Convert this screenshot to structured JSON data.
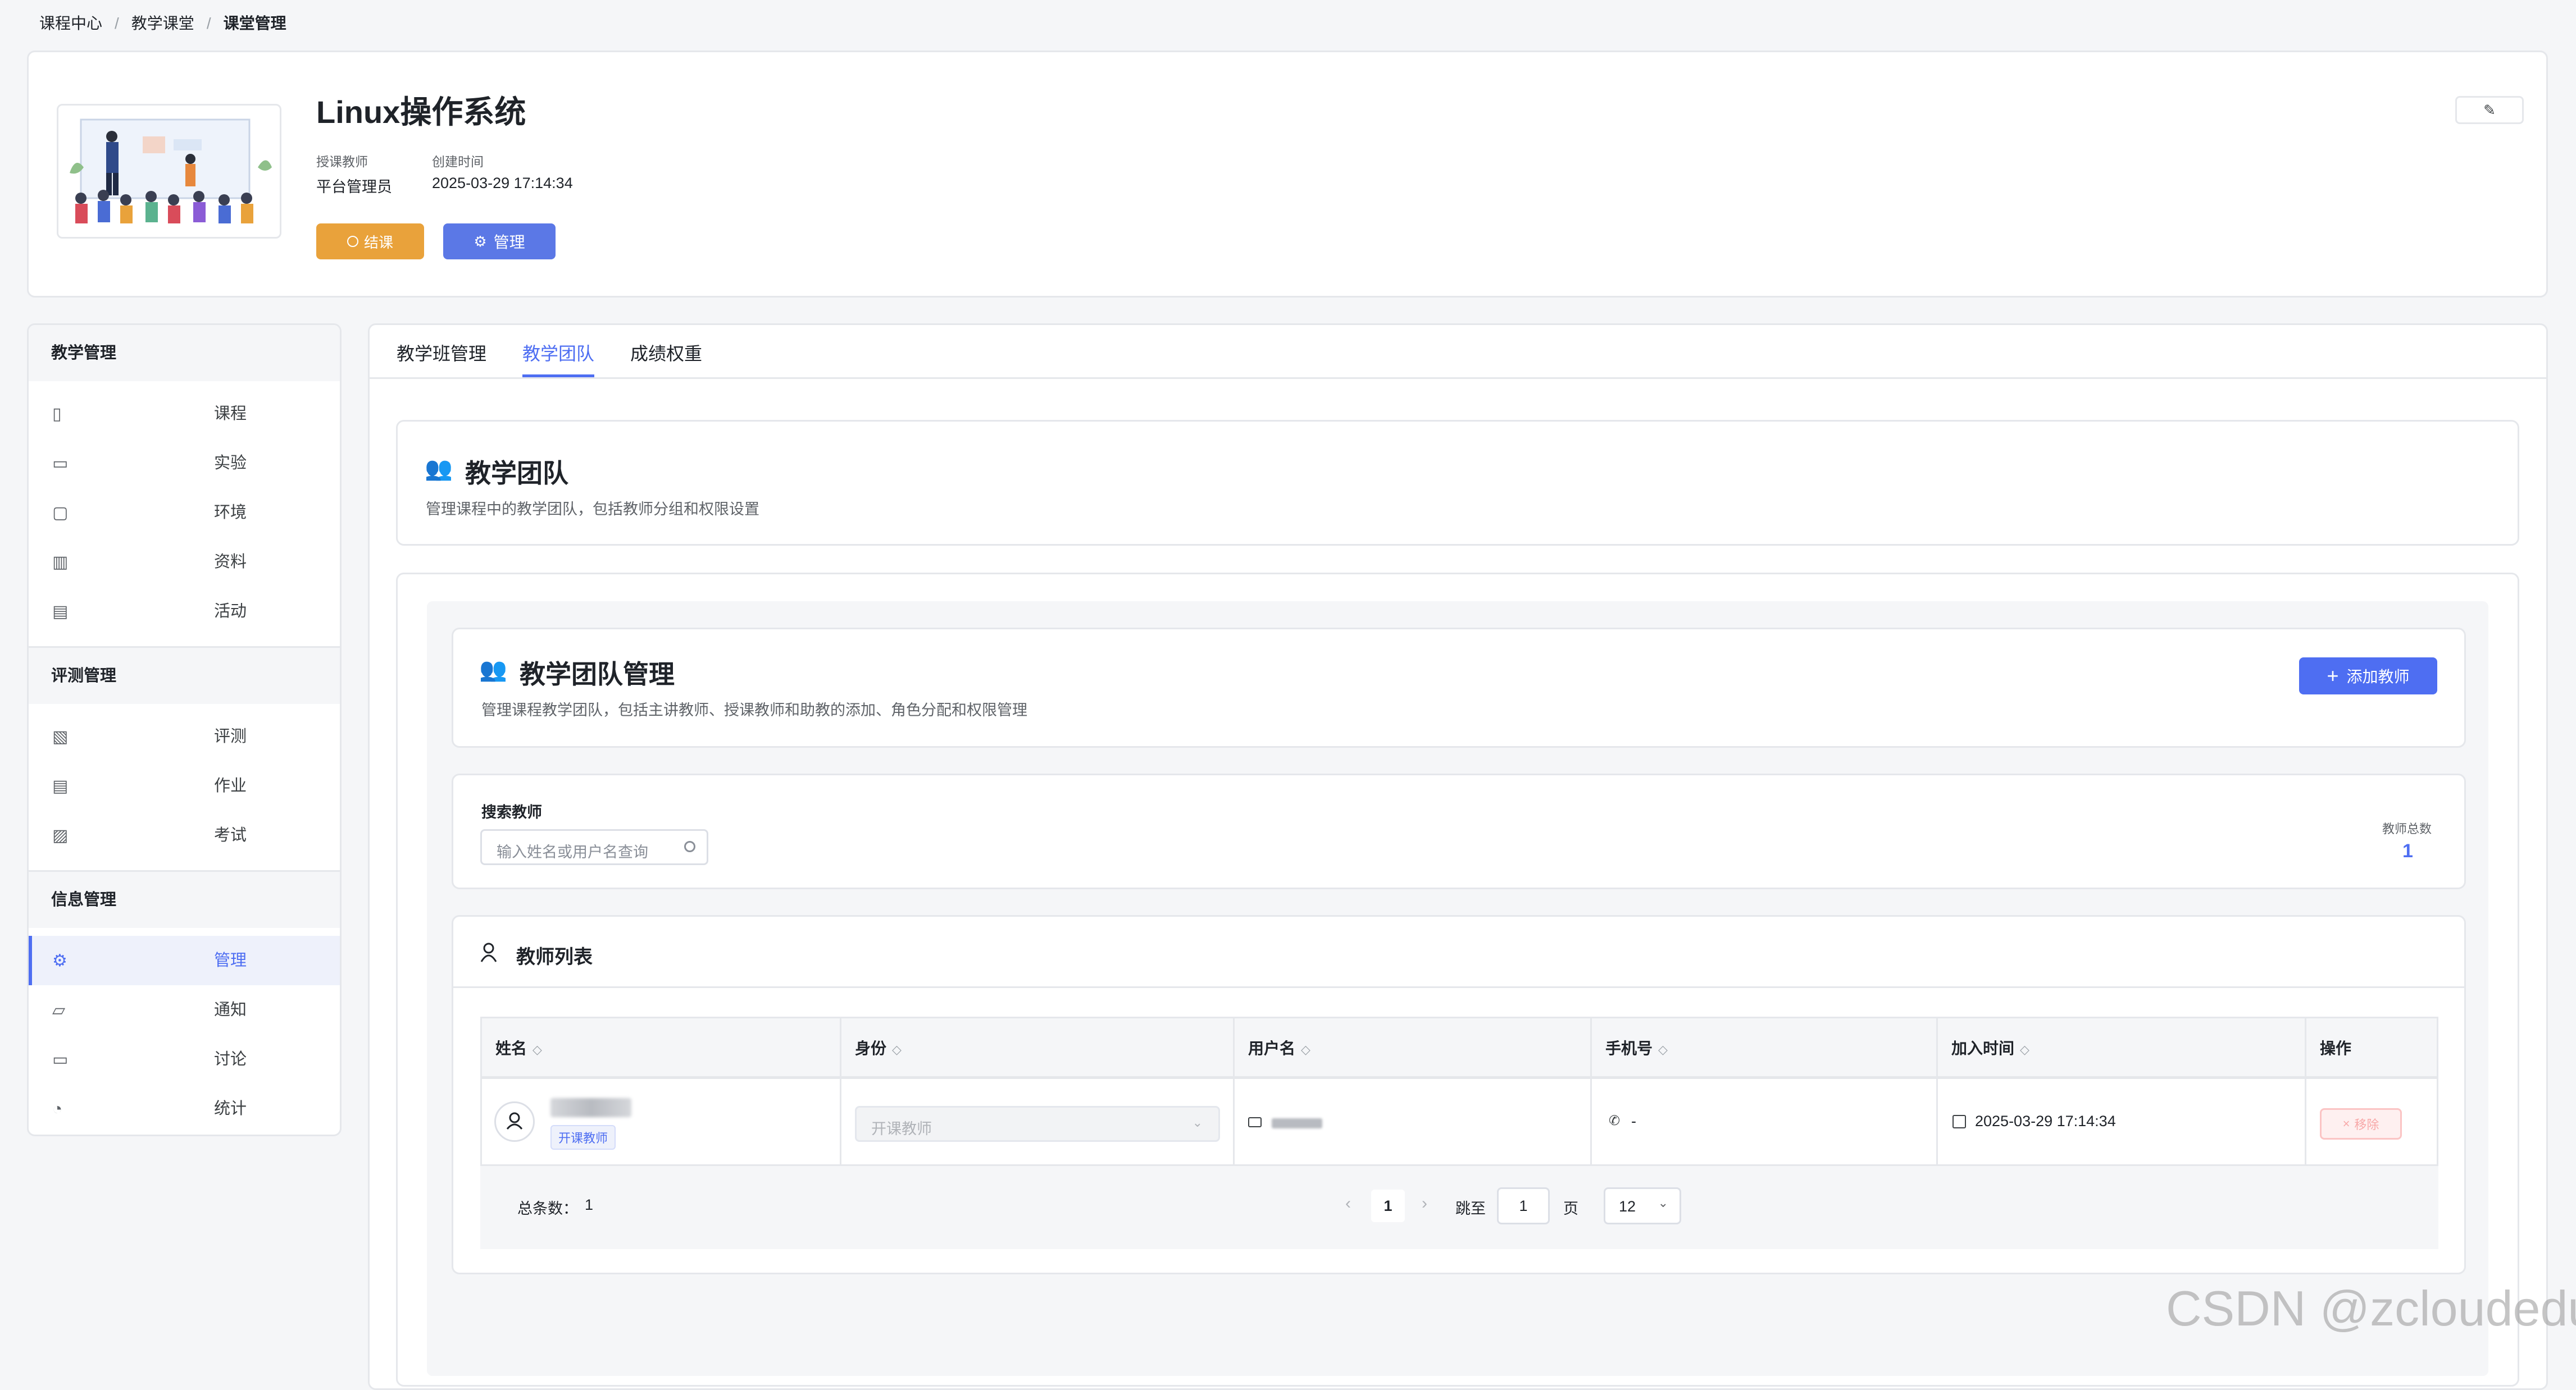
{
  "breadcrumb": [
    "课程中心",
    "教学课堂",
    "课堂管理"
  ],
  "course": {
    "title": "Linux操作系统",
    "teacher_label": "授课教师",
    "teacher_value": "平台管理员",
    "created_label": "创建时间",
    "created_value": "2025-03-29 17:14:34",
    "btn_end": "结课",
    "btn_manage": "管理"
  },
  "sidebar": {
    "sections": [
      {
        "title": "教学管理",
        "items": [
          {
            "label": "课程",
            "icon": "book-icon"
          },
          {
            "label": "实验",
            "icon": "monitor-icon"
          },
          {
            "label": "环境",
            "icon": "code-window-icon"
          },
          {
            "label": "资料",
            "icon": "bar-chart-icon"
          },
          {
            "label": "活动",
            "icon": "calendar-icon"
          }
        ]
      },
      {
        "title": "评测管理",
        "items": [
          {
            "label": "评测",
            "icon": "edit-doc-icon"
          },
          {
            "label": "作业",
            "icon": "doc-icon"
          },
          {
            "label": "考试",
            "icon": "exam-icon"
          }
        ]
      },
      {
        "title": "信息管理",
        "items": [
          {
            "label": "管理",
            "icon": "gear-icon",
            "active": true
          },
          {
            "label": "通知",
            "icon": "notice-icon"
          },
          {
            "label": "讨论",
            "icon": "chat-icon"
          },
          {
            "label": "统计",
            "icon": "pie-chart-icon"
          }
        ]
      }
    ]
  },
  "tabs": [
    "教学班管理",
    "教学团队",
    "成绩权重"
  ],
  "intro": {
    "title": "教学团队",
    "desc": "管理课程中的教学团队，包括教师分组和权限设置"
  },
  "mgmt": {
    "title": "教学团队管理",
    "desc": "管理课程教学团队，包括主讲教师、授课教师和助教的添加、角色分配和权限管理",
    "add_button": "添加教师"
  },
  "search": {
    "label": "搜索教师",
    "placeholder": "输入姓名或用户名查询",
    "total_label": "教师总数",
    "total_value": "1"
  },
  "list": {
    "title": "教师列表",
    "columns": [
      "姓名",
      "身份",
      "用户名",
      "手机号",
      "加入时间",
      "操作"
    ],
    "rows": [
      {
        "role_tag": "开课教师",
        "identity": "开课教师",
        "phone": "-",
        "joined": "2025-03-29 17:14:34",
        "action": "移除"
      }
    ]
  },
  "pagination": {
    "total_label": "总条数：",
    "total": "1",
    "current": "1",
    "goto_label": "跳至",
    "goto_value": "1",
    "page_suffix": "页",
    "page_size": "12"
  },
  "watermark": "CSDN @zcloudedu",
  "colors": {
    "primary": "#4e6ef2",
    "warning": "#e9a23b",
    "danger": "#f56c6c"
  }
}
